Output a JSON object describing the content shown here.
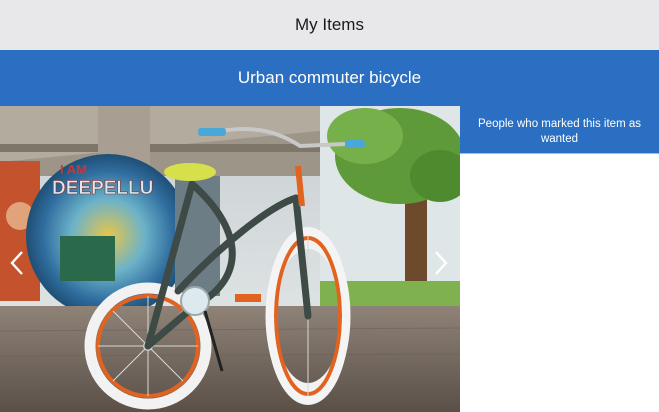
{
  "header": {
    "title": "My Items"
  },
  "item": {
    "title": "Urban commuter bicycle"
  },
  "gallery": {
    "prev_icon": "chevron-left-icon",
    "next_icon": "chevron-right-icon"
  },
  "sidebar": {
    "heading": "People who marked this item as wanted",
    "entries": []
  },
  "colors": {
    "accent": "#2b6fc2",
    "topbar_bg": "#e8e8ea"
  }
}
